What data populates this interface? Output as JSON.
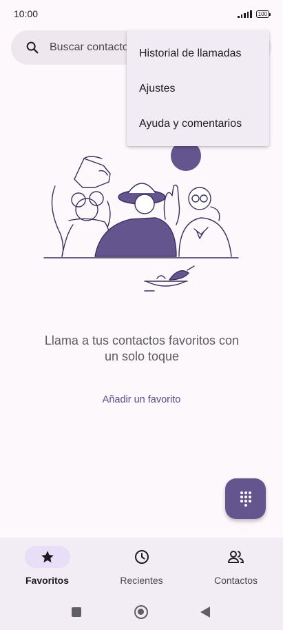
{
  "status_bar": {
    "time": "10:00",
    "battery": "100"
  },
  "search": {
    "placeholder": "Buscar contactos"
  },
  "menu": {
    "items": [
      {
        "label": "Historial de llamadas"
      },
      {
        "label": "Ajustes"
      },
      {
        "label": "Ayuda y comentarios"
      }
    ]
  },
  "empty_state": {
    "message": "Llama a tus contactos favoritos con un solo toque",
    "action_label": "Añadir un favorito"
  },
  "bottom_nav": {
    "tabs": [
      {
        "label": "Favoritos",
        "icon": "star-icon",
        "active": true
      },
      {
        "label": "Recientes",
        "icon": "clock-icon",
        "active": false
      },
      {
        "label": "Contactos",
        "icon": "people-icon",
        "active": false
      }
    ]
  },
  "colors": {
    "accent": "#65558f",
    "background": "#fdf8fc",
    "nav_background": "#f2ecf4",
    "active_pill": "#e8def8"
  }
}
